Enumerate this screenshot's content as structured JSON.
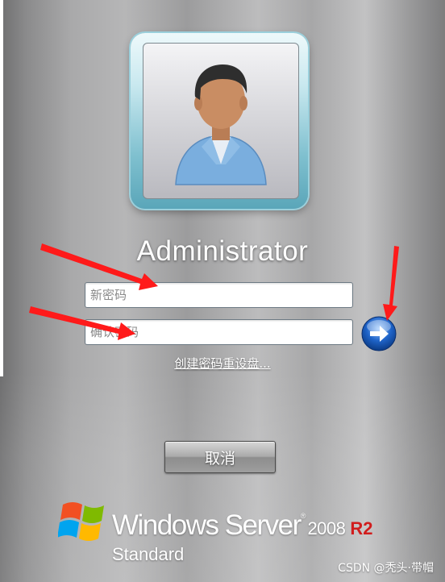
{
  "user": {
    "name": "Administrator"
  },
  "form": {
    "new_password_placeholder": "新密码",
    "confirm_password_placeholder": "确认密码",
    "submit_icon": "right-arrow-icon",
    "reset_disk_link": "创建密码重设盘..."
  },
  "actions": {
    "cancel_label": "取消"
  },
  "branding": {
    "product_name": "Windows Server",
    "trademark": "®",
    "version": "2008",
    "release": "R2",
    "edition": "Standard",
    "release_color": "#d11d1d"
  },
  "watermark": "CSDN @秃头·带帽",
  "colors": {
    "annotation_arrow": "#ff1a1a",
    "submit_button": "#1f64c9"
  }
}
